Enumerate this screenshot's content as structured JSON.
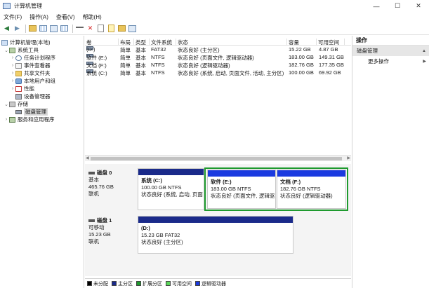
{
  "window": {
    "title": "计算机管理"
  },
  "menu": [
    "文件(F)",
    "操作(A)",
    "查看(V)",
    "帮助(H)"
  ],
  "tree": {
    "root": "计算机管理(本地)",
    "system_tools": "系统工具",
    "task_scheduler": "任务计划程序",
    "event_viewer": "事件查看器",
    "shared_folders": "共享文件夹",
    "local_users": "本地用户和组",
    "performance": "性能",
    "device_manager": "设备管理器",
    "storage": "存储",
    "disk_management": "磁盘管理",
    "services_apps": "服务和应用程序"
  },
  "volumes": {
    "headers": [
      "卷",
      "布局",
      "类型",
      "文件系统",
      "状态",
      "容量",
      "可用空间"
    ],
    "rows": [
      {
        "vol": "(D:)",
        "layout": "简单",
        "type": "基本",
        "fs": "FAT32",
        "status": "状态良好 (主分区)",
        "cap": "15.22 GB",
        "free": "4.87 GB"
      },
      {
        "vol": "软件 (E:)",
        "layout": "简单",
        "type": "基本",
        "fs": "NTFS",
        "status": "状态良好 (页面文件, 逻辑驱动器)",
        "cap": "183.00 GB",
        "free": "149.31 GB"
      },
      {
        "vol": "文档 (F:)",
        "layout": "简单",
        "type": "基本",
        "fs": "NTFS",
        "status": "状态良好 (逻辑驱动器)",
        "cap": "182.76 GB",
        "free": "177.35 GB"
      },
      {
        "vol": "系统 (C:)",
        "layout": "简单",
        "type": "基本",
        "fs": "NTFS",
        "status": "状态良好 (系统, 启动, 页面文件, 活动, 主分区)",
        "cap": "100.00 GB",
        "free": "69.92 GB"
      }
    ]
  },
  "disk0": {
    "name": "磁盘 0",
    "kind": "基本",
    "size": "465.76 GB",
    "state": "联机",
    "parts": [
      {
        "name": "系统 (C:)",
        "size": "100.00 GB NTFS",
        "status": "状态良好 (系统, 启动, 页面"
      },
      {
        "name": "软件 (E:)",
        "size": "183.00 GB NTFS",
        "status": "状态良好 (页面文件, 逻辑驱"
      },
      {
        "name": "文档 (F:)",
        "size": "182.76 GB NTFS",
        "status": "状态良好 (逻辑驱动器)"
      }
    ]
  },
  "disk1": {
    "name": "磁盘 1",
    "kind": "可移动",
    "size": "15.23 GB",
    "state": "联机",
    "part": {
      "name": "(D:)",
      "size": "15.23 GB FAT32",
      "status": "状态良好 (主分区)"
    }
  },
  "legend": [
    {
      "label": "未分配",
      "color": "#000000"
    },
    {
      "label": "主分区",
      "color": "#1a2a8a"
    },
    {
      "label": "扩展分区",
      "color": "#1e9a2e"
    },
    {
      "label": "可用空间",
      "color": "#5ad65a"
    },
    {
      "label": "逻辑驱动器",
      "color": "#1a3ae0"
    }
  ],
  "actions": {
    "header": "操作",
    "section": "磁盘管理",
    "more": "更多操作"
  }
}
